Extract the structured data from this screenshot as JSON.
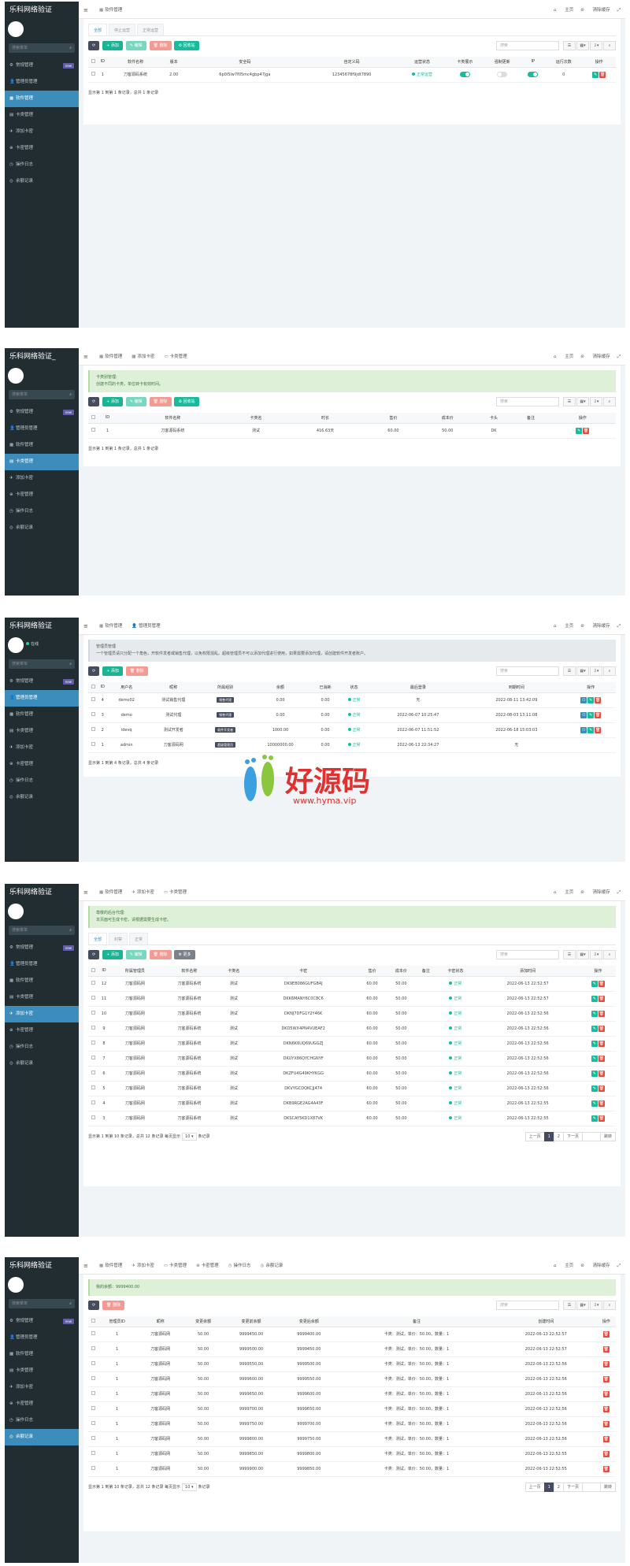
{
  "brand": "乐科网络验证",
  "brand2": "乐科网络验证_",
  "online": "在线",
  "search_menu": "搜索菜单",
  "menu": [
    {
      "icon": "⚙",
      "label": "常规管理",
      "badge": "new"
    },
    {
      "icon": "👤",
      "label": "管理员管理"
    },
    {
      "icon": "▦",
      "label": "软件管理"
    },
    {
      "icon": "▤",
      "label": "卡类管理"
    },
    {
      "icon": "✈",
      "label": "添加卡密"
    },
    {
      "icon": "⊕",
      "label": "卡密管理"
    },
    {
      "icon": "◷",
      "label": "操作日志"
    },
    {
      "icon": "◎",
      "label": "余额记录"
    }
  ],
  "top": {
    "home": "主页",
    "clear": "清除缓存"
  },
  "tabs": {
    "soft": "软件管理",
    "addcard": "添加卡密",
    "cardtype": "卡类管理",
    "admin": "管理员管理",
    "cardmgr": "卡密管理",
    "log": "操作日志",
    "balance": "余额记录"
  },
  "search": "搜索",
  "btns": {
    "add": "添加",
    "edit": "编辑",
    "del": "删除",
    "recycle": "回收站",
    "more": "更多"
  },
  "p1": {
    "subtabs": [
      "全部",
      "停止运营",
      "正常运营"
    ],
    "cols": [
      "ID",
      "软件名称",
      "版本",
      "安全码",
      "自定义码",
      "运营状态",
      "卡类展示",
      "强制更新",
      "IP",
      "运行次数",
      "操作"
    ],
    "row": {
      "id": "1",
      "name": "刀客源码系统",
      "ver": "2.00",
      "safe": "6p0l5lw7f05mc4gbp47jga",
      "code": "12345678f9jdt7890",
      "status": "正常运营",
      "runs": "0"
    },
    "foot": "显示第 1 到第 1 条记录，总共 1 条记录"
  },
  "p2": {
    "notice1": "卡类别管理:",
    "notice2": "创建不同的卡类，单位转卡有效时间。",
    "cols": [
      "ID",
      "软件名称",
      "卡类名",
      "时长",
      "售价",
      "成本价",
      "卡头",
      "备注",
      "操作"
    ],
    "row": {
      "id": "1",
      "soft": "刀客源码系统",
      "name": "测试",
      "time": "416.63天",
      "price": "60.00",
      "cost": "50.00",
      "head": "DK",
      "memo": ""
    },
    "foot": "显示第 1 到第 1 条记录，总共 1 条记录"
  },
  "p3": {
    "notice1": "管理员管理",
    "notice2": "一个管理员请只分配一个角色，开软件发者或销售代理，以免权限混乱。超级管理员不可以添加代理进行使用，如果需要添加代理，请创建软件开发者账户。",
    "cols": [
      "ID",
      "用户名",
      "昵称",
      "所属组别",
      "余额",
      "已消耗",
      "状态",
      "最后登录",
      "到期时间",
      "操作"
    ],
    "rows": [
      {
        "id": "4",
        "user": "demo02",
        "nick": "测试销售代理",
        "group": "销售代理",
        "bal": "0.00",
        "used": "0.00",
        "st": "正常",
        "last": "无",
        "exp": "2022-08-11 13:42:09"
      },
      {
        "id": "3",
        "user": "demo",
        "nick": "测试代理",
        "group": "销售代理",
        "bal": "0.00",
        "used": "0.00",
        "st": "正常",
        "last": "2022-06-07 10:25:47",
        "exp": "2022-08-03 13:11:08"
      },
      {
        "id": "2",
        "user": "idevq",
        "nick": "测试开发者",
        "group": "软件开发者",
        "bal": "1000.00",
        "used": "0.00",
        "st": "正常",
        "last": "2022-06-07 11:51:52",
        "exp": "2022-06-18 15:03:03"
      },
      {
        "id": "1",
        "user": "admin",
        "nick": "刀客源码网",
        "group": "超级管理员",
        "bal": "10000000.00",
        "used": "0.00",
        "st": "正常",
        "last": "2022-06-13 22:34:27",
        "exp": "无"
      }
    ],
    "foot": "显示第 1 到第 4 条记录，总共 4 条记录"
  },
  "p4": {
    "notice1": "尊敬的后台代理:",
    "notice2": "本页面可生成卡密，请根据需要生成卡密。",
    "subtabs": [
      "全部",
      "封禁",
      "正常"
    ],
    "cols": [
      "ID",
      "所属管理员",
      "软件名称",
      "卡类名",
      "卡密",
      "售价",
      "成本价",
      "备注",
      "卡密状态",
      "添加时间",
      "操作"
    ],
    "rows": [
      {
        "id": "12",
        "admin": "刀客源码网",
        "soft": "刀客源码系统",
        "type": "测试",
        "card": "DK9EB086GUFGB4J",
        "price": "60.00",
        "cost": "50.00",
        "st": "正常",
        "time": "2022-06-13 22:52:57"
      },
      {
        "id": "11",
        "admin": "刀客源码网",
        "soft": "刀客源码系统",
        "type": "测试",
        "card": "DKK6MANY6C0C8C6",
        "price": "60.00",
        "cost": "50.00",
        "st": "正常",
        "time": "2022-06-13 22:52:57"
      },
      {
        "id": "10",
        "admin": "刀客源码网",
        "soft": "刀客源码系统",
        "type": "测试",
        "card": "DKNJ7DFG1Y2Y46K",
        "price": "60.00",
        "cost": "50.00",
        "st": "正常",
        "time": "2022-06-13 22:52:56"
      },
      {
        "id": "9",
        "admin": "刀客源码网",
        "soft": "刀客源码系统",
        "type": "测试",
        "card": "DKD5WX4PN4VUEAF2",
        "price": "60.00",
        "cost": "50.00",
        "st": "正常",
        "time": "2022-06-13 22:52:56"
      },
      {
        "id": "8",
        "admin": "刀客源码网",
        "soft": "刀客源码系统",
        "type": "测试",
        "card": "DKN6K6UQ69UGGZJ",
        "price": "60.00",
        "cost": "50.00",
        "st": "正常",
        "time": "2022-06-13 22:52:56"
      },
      {
        "id": "7",
        "admin": "刀客源码网",
        "soft": "刀客源码系统",
        "type": "测试",
        "card": "DKUYX86QYCHGNYF",
        "price": "60.00",
        "cost": "50.00",
        "st": "正常",
        "time": "2022-06-13 22:52:56"
      },
      {
        "id": "6",
        "admin": "刀客源码网",
        "soft": "刀客源码系统",
        "type": "测试",
        "card": "DKZFU4G49KHYKGG",
        "price": "60.00",
        "cost": "50.00",
        "st": "正常",
        "time": "2022-06-13 22:52:56"
      },
      {
        "id": "5",
        "admin": "刀客源码网",
        "soft": "刀客源码系统",
        "type": "测试",
        "card": "DKVYGCDQKCJJ474",
        "price": "60.00",
        "cost": "50.00",
        "st": "正常",
        "time": "2022-06-13 22:52:56"
      },
      {
        "id": "4",
        "admin": "刀客源码网",
        "soft": "刀客源码系统",
        "type": "测试",
        "card": "DKB9RGE2AG4A43F",
        "price": "60.00",
        "cost": "50.00",
        "st": "正常",
        "time": "2022-06-13 22:52:55"
      },
      {
        "id": "3",
        "admin": "刀客源码网",
        "soft": "刀客源码系统",
        "type": "测试",
        "card": "DKSCAY5KD1X87VK",
        "price": "60.00",
        "cost": "50.00",
        "st": "正常",
        "time": "2022-06-13 22:52:55"
      }
    ],
    "foot1": "显示第 1 到第 10 条记录，总共 12 条记录 每页显示",
    "pagesize": "10",
    "foot2": "条记录",
    "pager": {
      "prev": "上一页",
      "p1": "1",
      "p2": "2",
      "next": "下一页",
      "go": "跳转"
    }
  },
  "p5": {
    "notice1": "我的余额：9999400.00",
    "cols": [
      "管理员ID",
      "昵称",
      "变更余额",
      "变更前余额",
      "变更后余额",
      "备注",
      "创建时间",
      "操作"
    ],
    "rows": [
      {
        "aid": "1",
        "nick": "刀客源码网",
        "chg": "50.00",
        "before": "9999450.00",
        "after": "9999400.00",
        "memo": "卡类：测试，单价：50.00，数量：1",
        "time": "2022-06-13 22:52:57"
      },
      {
        "aid": "1",
        "nick": "刀客源码网",
        "chg": "50.00",
        "before": "9999500.00",
        "after": "9999450.00",
        "memo": "卡类：测试，单价：50.00，数量：1",
        "time": "2022-06-13 22:52:57"
      },
      {
        "aid": "1",
        "nick": "刀客源码网",
        "chg": "50.00",
        "before": "9999550.00",
        "after": "9999500.00",
        "memo": "卡类：测试，单价：50.00，数量：1",
        "time": "2022-06-13 22:52:56"
      },
      {
        "aid": "1",
        "nick": "刀客源码网",
        "chg": "50.00",
        "before": "9999600.00",
        "after": "9999550.00",
        "memo": "卡类：测试，单价：50.00，数量：1",
        "time": "2022-06-13 22:52:56"
      },
      {
        "aid": "1",
        "nick": "刀客源码网",
        "chg": "50.00",
        "before": "9999650.00",
        "after": "9999600.00",
        "memo": "卡类：测试，单价：50.00，数量：1",
        "time": "2022-06-13 22:52:56"
      },
      {
        "aid": "1",
        "nick": "刀客源码网",
        "chg": "50.00",
        "before": "9999700.00",
        "after": "9999650.00",
        "memo": "卡类：测试，单价：50.00，数量：1",
        "time": "2022-06-13 22:52:56"
      },
      {
        "aid": "1",
        "nick": "刀客源码网",
        "chg": "50.00",
        "before": "9999750.00",
        "after": "9999700.00",
        "memo": "卡类：测试，单价：50.00，数量：1",
        "time": "2022-06-13 22:52:56"
      },
      {
        "aid": "1",
        "nick": "刀客源码网",
        "chg": "50.00",
        "before": "9999800.00",
        "after": "9999750.00",
        "memo": "卡类：测试，单价：50.00，数量：1",
        "time": "2022-06-13 22:52:56"
      },
      {
        "aid": "1",
        "nick": "刀客源码网",
        "chg": "50.00",
        "before": "9999850.00",
        "after": "9999800.00",
        "memo": "卡类：测试，单价：50.00，数量：1",
        "time": "2022-06-13 22:52:55"
      },
      {
        "aid": "1",
        "nick": "刀客源码网",
        "chg": "50.00",
        "before": "9999900.00",
        "after": "9999850.00",
        "memo": "卡类：测试，单价：50.00，数量：1",
        "time": "2022-06-13 22:52:55"
      }
    ],
    "foot1": "显示第 1 到第 10 条记录，总共 12 条记录 每页显示",
    "pagesize": "10",
    "foot2": "条记录",
    "pager": {
      "prev": "上一页",
      "p1": "1",
      "p2": "2",
      "next": "下一页",
      "go": "跳转"
    }
  },
  "watermark": {
    "text": "好源码",
    "url": "www.hyma.vip"
  }
}
